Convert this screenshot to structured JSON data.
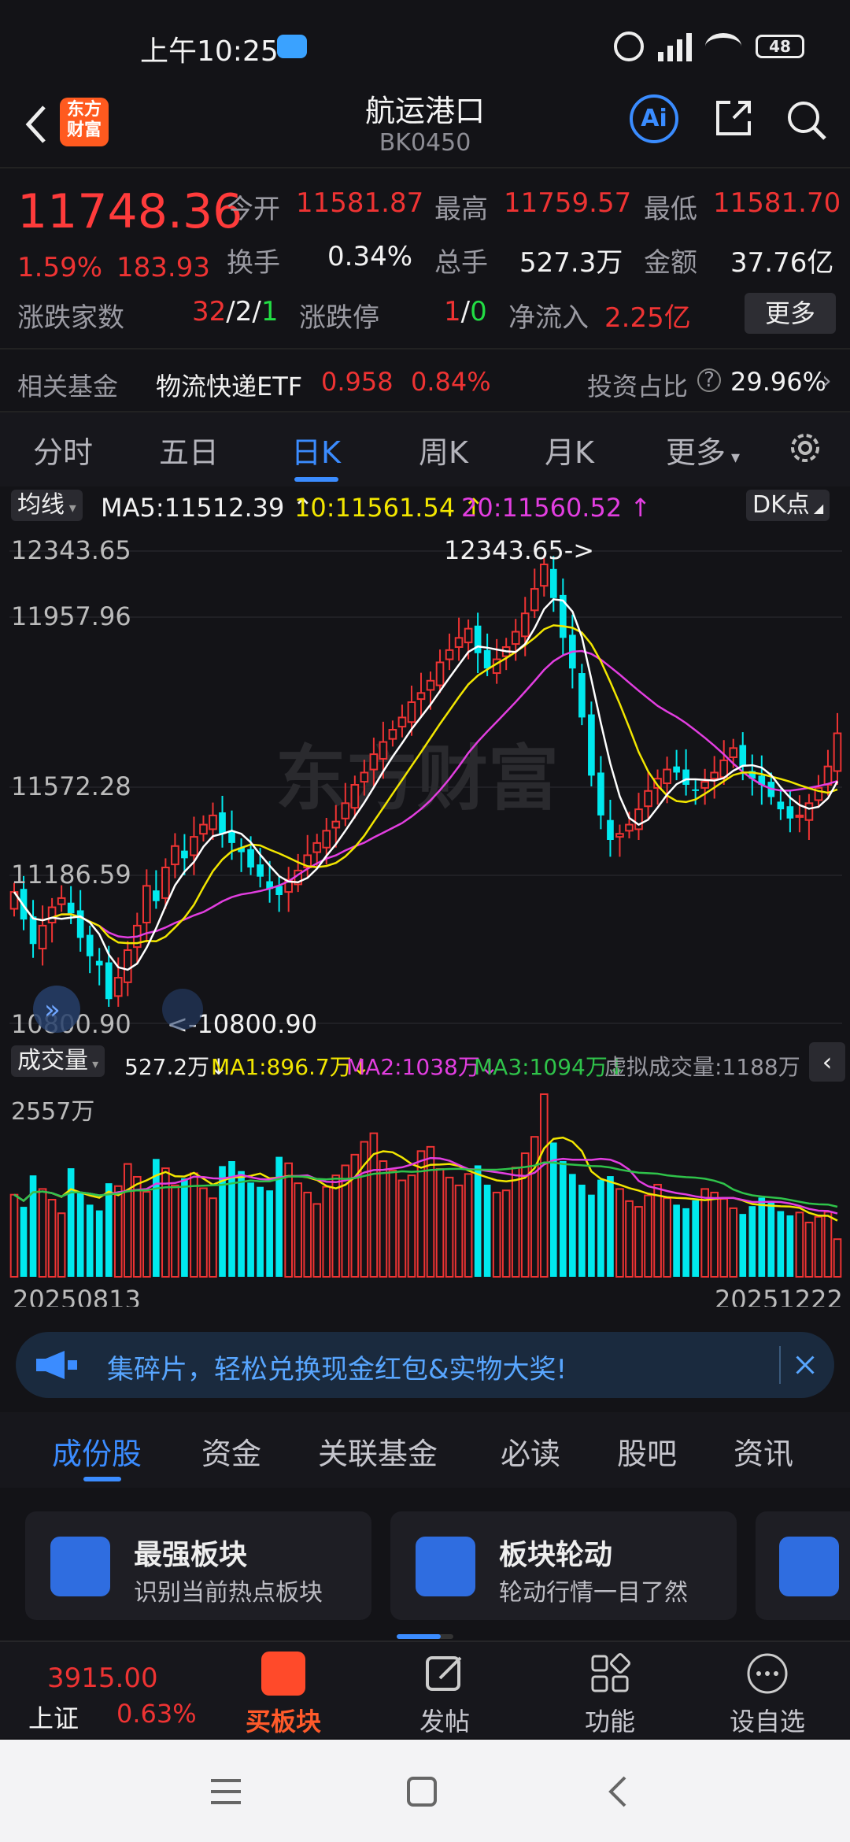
{
  "status_bar": {
    "time": "上午10:25",
    "battery": "48"
  },
  "header": {
    "title": "航运港口",
    "code": "BK0450",
    "logo_text": "东方财富",
    "ai_label": "Ai"
  },
  "quote": {
    "price": "11748.36",
    "pct": "1.59%",
    "change": "183.93",
    "open_label": "今开",
    "open": "11581.87",
    "high_label": "最高",
    "high": "11759.57",
    "low_label": "最低",
    "low": "11581.70",
    "turnover_label": "换手",
    "turnover": "0.34%",
    "volume_label": "总手",
    "volume": "527.3万",
    "amount_label": "金额",
    "amount": "37.76亿",
    "breadth_label": "涨跌家数",
    "breadth_up": "32",
    "breadth_flat": "2",
    "breadth_down": "1",
    "limit_label": "涨跌停",
    "limit_up": "1",
    "limit_down": "0",
    "netflow_label": "净流入",
    "netflow": "2.25亿",
    "more_label": "更多",
    "fund_label": "相关基金",
    "fund_name": "物流快递ETF",
    "fund_price": "0.958",
    "fund_pct": "0.84%",
    "invest_label": "投资占比",
    "invest_pct": "29.96%"
  },
  "tabs": [
    "分时",
    "五日",
    "日K",
    "周K",
    "月K",
    "更多"
  ],
  "ma": {
    "label": "均线",
    "ma5": "MA5:11512.39",
    "ma10": "10:11561.54",
    "ma20": "20:11560.52",
    "dk": "DK点"
  },
  "chart_labels": {
    "y_max": "12343.65",
    "y_2": "11957.96",
    "y_3": "11572.28",
    "y_4": "11186.59",
    "y_min": "10800.90",
    "high_annot": "12343.65->",
    "low_annot": "<-10800.90",
    "watermark": "东方财富"
  },
  "volume_bar": {
    "label": "成交量",
    "vol": "527.2万",
    "ma1": "MA1:896.7万",
    "ma2": "MA2:1038万",
    "ma3": "MA3:1094万",
    "virtual": "虚拟成交量:1188万",
    "max": "2557万",
    "date_start": "20250813",
    "date_end": "20251222"
  },
  "chart_data": {
    "type": "candlestick",
    "x_range": [
      "20250813",
      "20251222"
    ],
    "y_range": [
      10800.9,
      12343.65
    ],
    "closes": [
      11230,
      11140,
      11060,
      11120,
      11180,
      11210,
      11160,
      11080,
      11020,
      10990,
      10880,
      10950,
      11040,
      11120,
      11250,
      11200,
      11310,
      11380,
      11340,
      11410,
      11450,
      11480,
      11420,
      11390,
      11360,
      11310,
      11280,
      11240,
      11220,
      11270,
      11300,
      11350,
      11390,
      11430,
      11460,
      11520,
      11580,
      11620,
      11680,
      11720,
      11760,
      11800,
      11850,
      11880,
      11920,
      11980,
      12020,
      12060,
      12090,
      12010,
      11960,
      11990,
      12030,
      12080,
      12140,
      12220,
      12300,
      12190,
      12060,
      11960,
      11800,
      11610,
      11480,
      11400,
      11420,
      11450,
      11500,
      11560,
      11600,
      11630,
      11620,
      11580,
      11560,
      11590,
      11620,
      11660,
      11700,
      11640,
      11600,
      11580,
      11540,
      11500,
      11470,
      11480,
      11520,
      11570,
      11640,
      11748.36
    ],
    "volumes_wan": [
      1150,
      980,
      1420,
      1230,
      1080,
      890,
      1520,
      1190,
      1010,
      930,
      1310,
      1270,
      1580,
      1400,
      1190,
      1650,
      1520,
      1280,
      1380,
      1450,
      1240,
      1100,
      1550,
      1620,
      1480,
      1320,
      1260,
      1210,
      1680,
      1590,
      1310,
      1180,
      1020,
      1260,
      1420,
      1560,
      1710,
      1890,
      2010,
      1620,
      1490,
      1350,
      1420,
      1760,
      1820,
      1510,
      1390,
      1280,
      1440,
      1560,
      1290,
      1180,
      1210,
      1530,
      1730,
      1960,
      2557,
      1880,
      1620,
      1440,
      1290,
      1150,
      1360,
      1410,
      1230,
      1060,
      980,
      1140,
      1290,
      1100,
      1010,
      960,
      1070,
      1230,
      1180,
      1090,
      960,
      880,
      990,
      1110,
      1040,
      920,
      860,
      900,
      760,
      840,
      910,
      527.2
    ]
  },
  "banner": {
    "text": "集碎片，轻松兑换现金红包&实物大奖!"
  },
  "subtabs": [
    "成份股",
    "资金",
    "关联基金",
    "必读",
    "股吧",
    "资讯"
  ],
  "cards": [
    {
      "title": "最强板块",
      "desc": "识别当前热点板块"
    },
    {
      "title": "板块轮动",
      "desc": "轮动行情一目了然"
    }
  ],
  "bottom_nav": {
    "index_value": "3915.00",
    "index_name": "上证",
    "index_pct": "0.63%",
    "buy": "买板块",
    "post": "发帖",
    "func": "功能",
    "watch": "设自选"
  },
  "colors": {
    "up": "#ee3333",
    "down": "#00e9ee",
    "ma5": "#ffffff",
    "ma10": "#f2e600",
    "ma20": "#e23ee0",
    "accent": "#3b8cff"
  }
}
